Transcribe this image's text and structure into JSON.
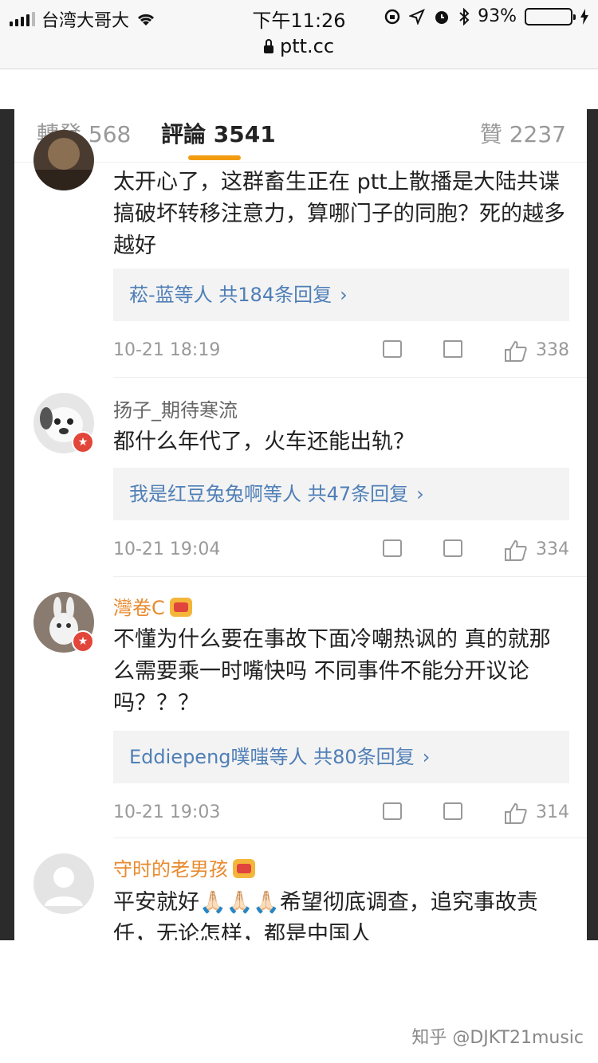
{
  "status_bar": {
    "carrier": "台湾大哥大",
    "time": "下午11:26",
    "battery_percent": "93%",
    "battery_level": 0.93
  },
  "browser": {
    "url": "ptt.cc"
  },
  "tabs": [
    {
      "label": "轉發 568"
    },
    {
      "label": "評論 3541"
    },
    {
      "label": "贊 2237"
    }
  ],
  "comments": [
    {
      "name": "",
      "text": "太开心了，这群畜生正在 ptt上散播是大陆共谍搞破坏转移注意力，算哪门子的同胞？死的越多越好",
      "reply": "菘-蓝等人 共184条回复",
      "time": "10-21 18:19",
      "likes": "338"
    },
    {
      "name": "扬子_期待寒流",
      "text": "都什么年代了，火车还能出轨？",
      "reply": "我是红豆兔兔啊等人 共47条回复",
      "time": "10-21 19:04",
      "likes": "334"
    },
    {
      "name": "灣卷C",
      "text": "不懂为什么要在事故下面冷嘲热讽的 真的就那么需要乘一时嘴快吗 不同事件不能分开议论吗？？？",
      "reply": "Eddiepeng噗嗤等人 共80条回复",
      "time": "10-21 19:03",
      "likes": "314"
    },
    {
      "name": "守时的老男孩",
      "text": "平安就好🙏🏻🙏🏻🙏🏻希望彻底调查，追究事故责任，无论怎样，都是中国人"
    }
  ],
  "icons": {
    "reply_chevron": "›",
    "share": "share-icon",
    "comment": "comment-icon",
    "like": "thumbs-up-icon"
  },
  "watermark": "知乎 @DJKT21music"
}
